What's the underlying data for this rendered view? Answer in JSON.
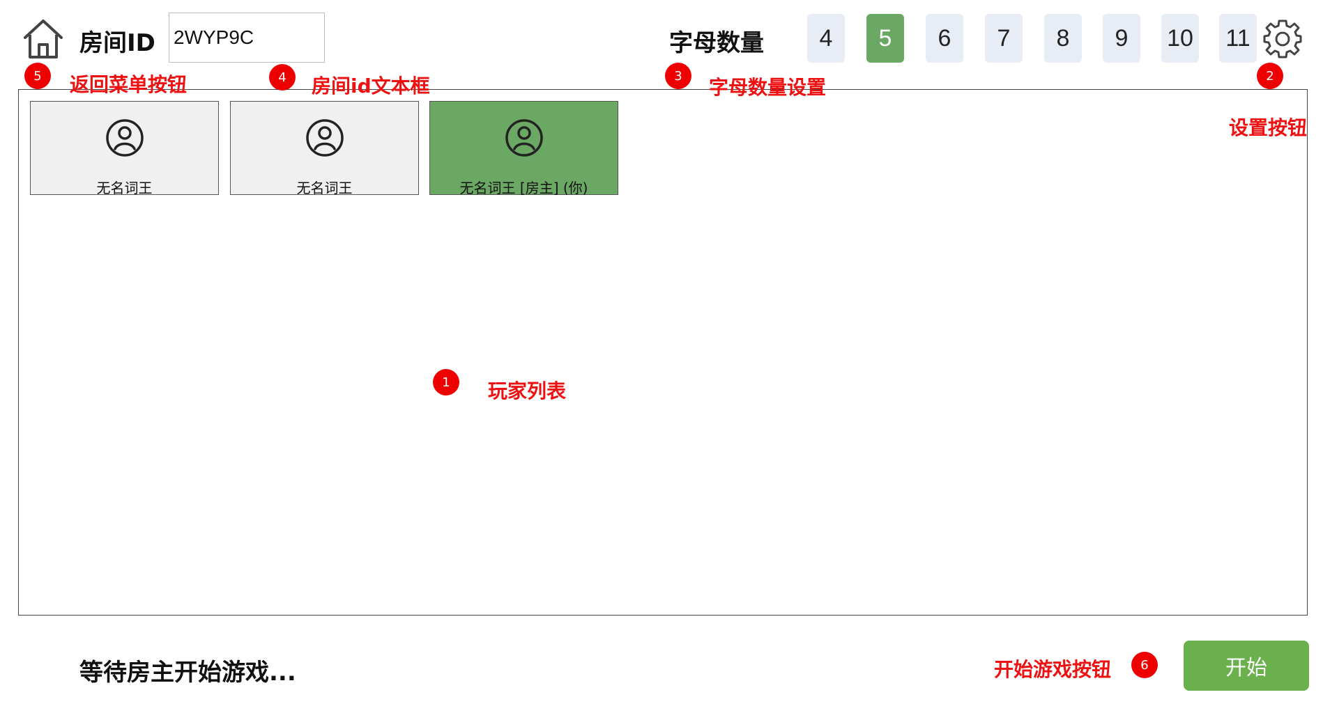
{
  "header": {
    "room_label": "房间ID",
    "room_id_value": "2WYP9C",
    "letters_label": "字母数量",
    "letter_counts": [
      "4",
      "5",
      "6",
      "7",
      "8",
      "9",
      "10",
      "11"
    ],
    "selected_letter_count": "5"
  },
  "icons": {
    "home": "home-icon",
    "settings": "gear-icon",
    "avatar": "user-circle-icon"
  },
  "players": [
    {
      "name": "无名词王",
      "is_host": false
    },
    {
      "name": "无名词王",
      "is_host": false
    },
    {
      "name": "无名词王 [房主] (你)",
      "is_host": true
    }
  ],
  "footer": {
    "status": "等待房主开始游戏...",
    "start_label": "开始"
  },
  "annotations": [
    {
      "number": "1",
      "label": "玩家列表"
    },
    {
      "number": "2",
      "label": "设置按钮"
    },
    {
      "number": "3",
      "label": "字母数量设置"
    },
    {
      "number": "4",
      "label": "房间id文本框"
    },
    {
      "number": "5",
      "label": "返回菜单按钮"
    },
    {
      "number": "6",
      "label": "开始游戏按钮"
    }
  ],
  "colors": {
    "selected_green": "#6aa863",
    "start_button_green": "#6ab04c",
    "number_button_bg": "#e8edf5",
    "annotation_red": "#ee1111"
  }
}
